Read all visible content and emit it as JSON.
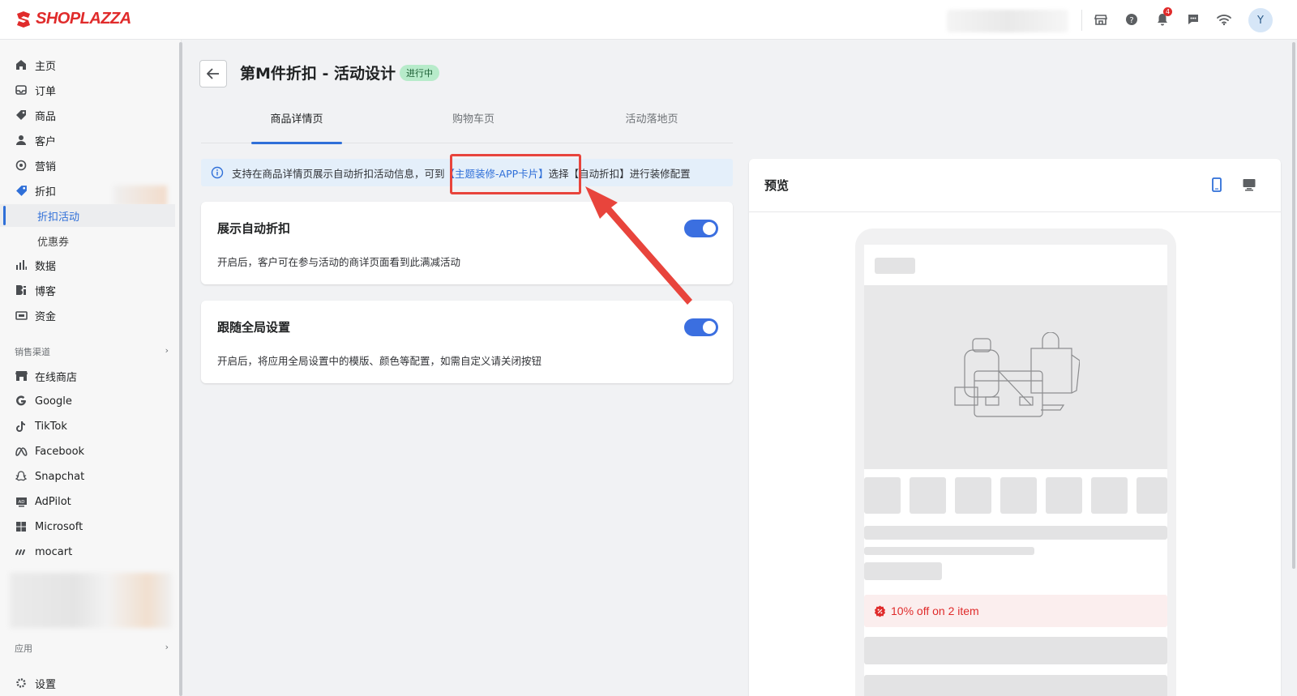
{
  "brand": {
    "name": "SHOPLAZZA",
    "color": "#e02b2b"
  },
  "topbar": {
    "icons": [
      "store-icon",
      "help-icon",
      "bell-icon",
      "chat-icon",
      "wifi-icon"
    ],
    "notification_count": "4",
    "avatar_initial": "Y"
  },
  "sidebar": {
    "items": [
      {
        "label": "主页",
        "icon": "home-icon"
      },
      {
        "label": "订单",
        "icon": "inbox-icon"
      },
      {
        "label": "商品",
        "icon": "tag-icon"
      },
      {
        "label": "客户",
        "icon": "person-icon"
      },
      {
        "label": "营销",
        "icon": "target-icon"
      },
      {
        "label": "折扣",
        "icon": "discount-icon"
      }
    ],
    "discount_sub": [
      {
        "label": "折扣活动",
        "active": true
      },
      {
        "label": "优惠券",
        "active": false
      }
    ],
    "items2": [
      {
        "label": "数据",
        "icon": "bar-chart-icon"
      },
      {
        "label": "博客",
        "icon": "blog-icon"
      },
      {
        "label": "资金",
        "icon": "wallet-icon"
      }
    ],
    "sales_channels_label": "销售渠道",
    "channels": [
      {
        "label": "在线商店",
        "icon": "store-icon"
      },
      {
        "label": "Google",
        "icon": "google-icon"
      },
      {
        "label": "TikTok",
        "icon": "tiktok-icon"
      },
      {
        "label": "Facebook",
        "icon": "meta-icon"
      },
      {
        "label": "Snapchat",
        "icon": "snapchat-icon"
      },
      {
        "label": "AdPilot",
        "icon": "adpilot-icon"
      },
      {
        "label": "Microsoft",
        "icon": "microsoft-icon"
      },
      {
        "label": "mocart",
        "icon": "mocart-icon"
      }
    ],
    "apps_label": "应用",
    "settings_label": "设置"
  },
  "header": {
    "title": "第M件折扣 - 活动设计",
    "status": "进行中"
  },
  "tabs": [
    {
      "label": "商品详情页",
      "active": true
    },
    {
      "label": "购物车页",
      "active": false
    },
    {
      "label": "活动落地页",
      "active": false
    }
  ],
  "banner": {
    "text_before": "支持在商品详情页展示自动折扣活动信息，可到",
    "link": "【主题装修-APP卡片】",
    "text_after": "选择【自动折扣】进行装修配置"
  },
  "cards": [
    {
      "title": "展示自动折扣",
      "desc": "开启后，客户可在参与活动的商详页面看到此满减活动",
      "enabled": true
    },
    {
      "title": "跟随全局设置",
      "desc": "开启后，将应用全局设置中的模版、颜色等配置，如需自定义请关闭按钮",
      "enabled": true
    }
  ],
  "preview": {
    "title": "预览",
    "device_icons": [
      "mobile-icon",
      "desktop-icon"
    ],
    "discount_text": "10% off on 2 item"
  },
  "colors": {
    "accent": "#2f6fd8",
    "toggle": "#3b6fe0",
    "annotation": "#e8443c",
    "badge_bg": "#b7ebca"
  }
}
